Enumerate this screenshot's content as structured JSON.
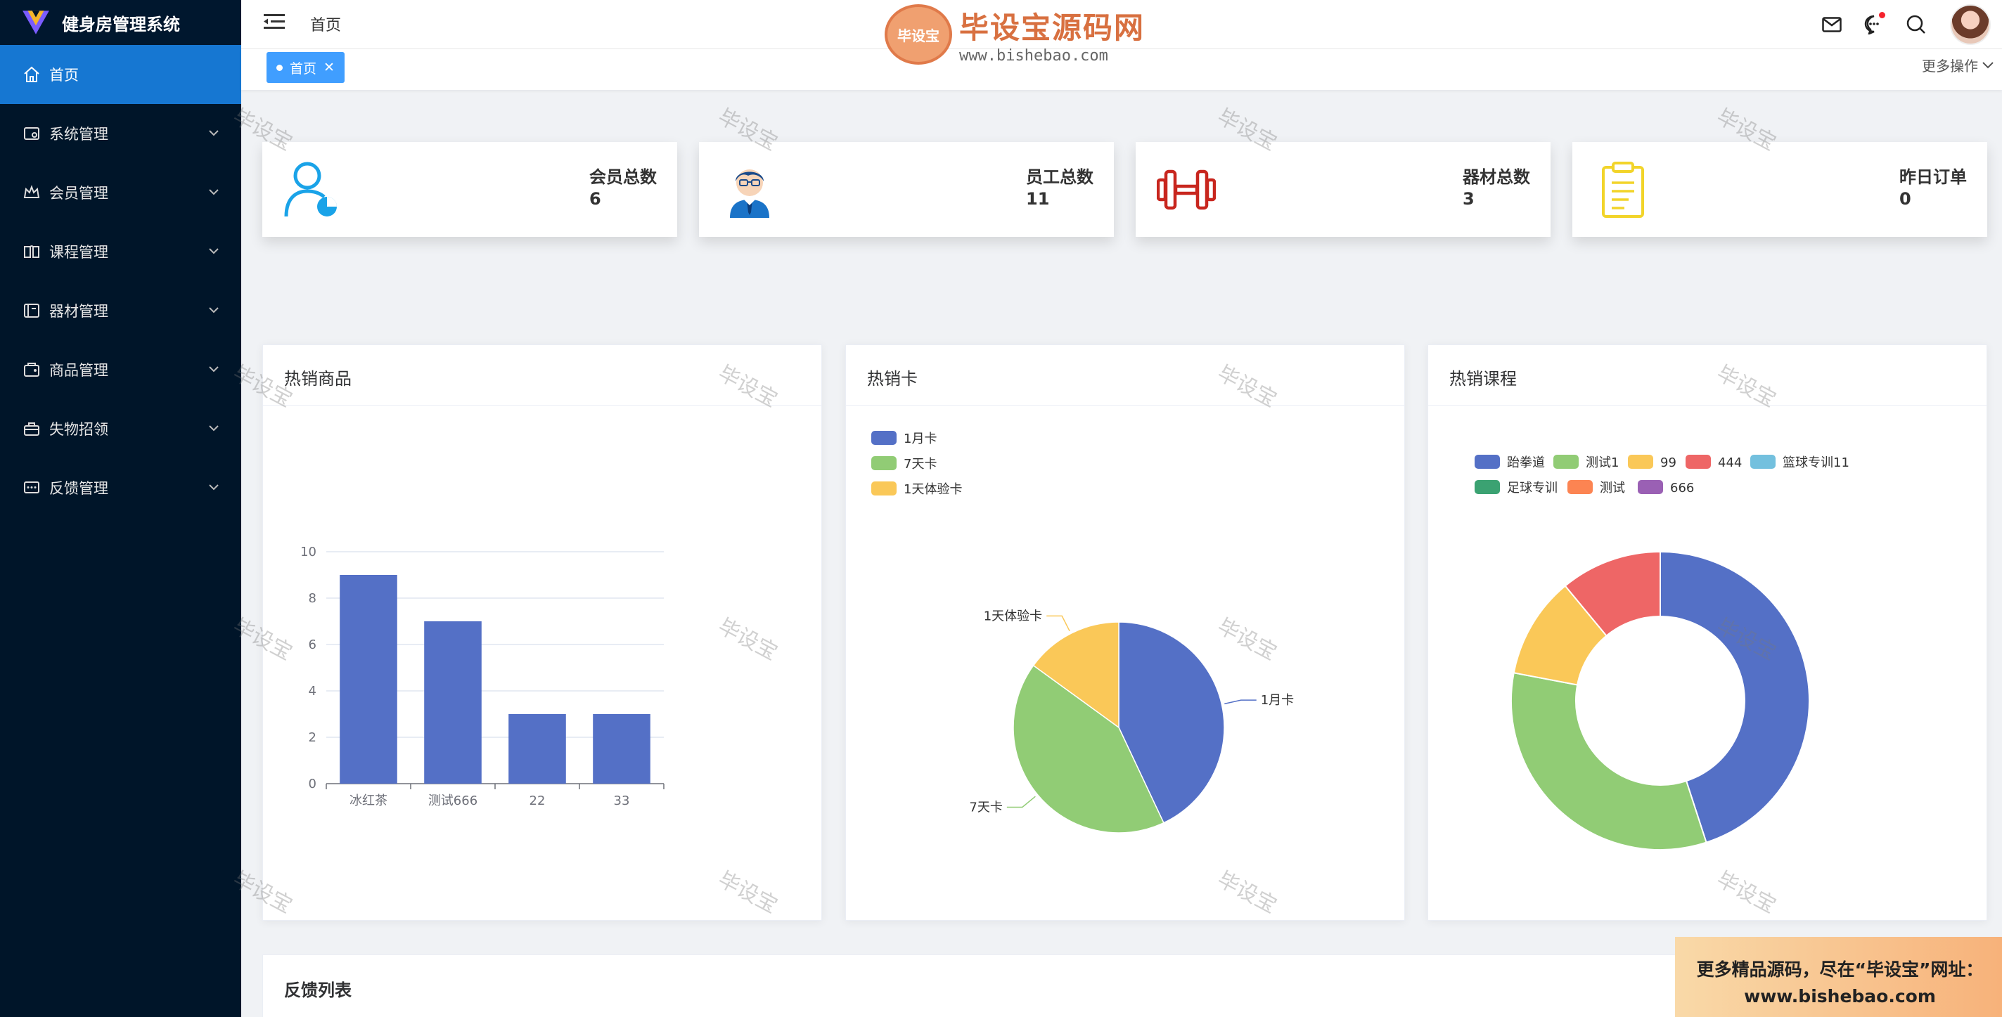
{
  "app": {
    "title": "健身房管理系统"
  },
  "sidebar": {
    "items": [
      {
        "label": "首页",
        "icon": "home-icon",
        "active": true
      },
      {
        "label": "系统管理",
        "icon": "settings-icon"
      },
      {
        "label": "会员管理",
        "icon": "crown-icon"
      },
      {
        "label": "课程管理",
        "icon": "book-icon"
      },
      {
        "label": "器材管理",
        "icon": "equipment-icon"
      },
      {
        "label": "商品管理",
        "icon": "product-icon"
      },
      {
        "label": "失物招领",
        "icon": "briefcase-icon"
      },
      {
        "label": "反馈管理",
        "icon": "feedback-icon"
      }
    ]
  },
  "header": {
    "breadcrumb": "首页",
    "more_ops": "更多操作"
  },
  "tags": [
    {
      "label": "首页"
    }
  ],
  "stats": [
    {
      "label": "会员总数",
      "value": "6",
      "icon": "member-icon",
      "color": "#1aa3e8"
    },
    {
      "label": "员工总数",
      "value": "11",
      "icon": "employee-icon",
      "color": "#1a73c8"
    },
    {
      "label": "器材总数",
      "value": "3",
      "icon": "dumbbell-icon",
      "color": "#c8261e"
    },
    {
      "label": "昨日订单",
      "value": "0",
      "icon": "clipboard-icon",
      "color": "#f2d42a"
    }
  ],
  "panels": {
    "hot_products": "热销商品",
    "hot_cards": "热销卡",
    "hot_courses": "热销课程"
  },
  "chart_data": [
    {
      "type": "bar",
      "title": "热销商品",
      "categories": [
        "冰红茶",
        "测试666",
        "22",
        "33"
      ],
      "values": [
        9,
        7,
        3,
        3
      ],
      "ylim": [
        0,
        10
      ],
      "yticks": [
        0,
        2,
        4,
        6,
        8,
        10
      ],
      "color": "#5470c6",
      "grid": true
    },
    {
      "type": "pie",
      "title": "热销卡",
      "labels": [
        "1月卡",
        "7天卡",
        "1天体验卡"
      ],
      "values": [
        43,
        42,
        15
      ],
      "colors": [
        "#5470c6",
        "#91cc75",
        "#fac858"
      ],
      "legend": "top-left"
    },
    {
      "type": "pie",
      "title": "热销课程",
      "labels": [
        "跆拳道",
        "测试1",
        "99",
        "444",
        "篮球专训11",
        "足球专训",
        "测试",
        "666"
      ],
      "values": [
        45,
        33,
        11,
        11,
        0,
        0,
        0,
        0
      ],
      "colors": [
        "#5470c6",
        "#91cc75",
        "#fac858",
        "#ee6666",
        "#73c0de",
        "#3ba272",
        "#fc8452",
        "#9a60b4"
      ],
      "donut": true,
      "legend": "top"
    }
  ],
  "feedback": {
    "title": "反馈列表"
  },
  "watermark": {
    "text": "毕设宝",
    "brand": "毕设宝源码网",
    "url": "www.bishebao.com",
    "badge": "毕设宝",
    "promo_line1": "更多精品源码，尽在“毕设宝”网址：",
    "promo_line2": "www.bishebao.com"
  }
}
